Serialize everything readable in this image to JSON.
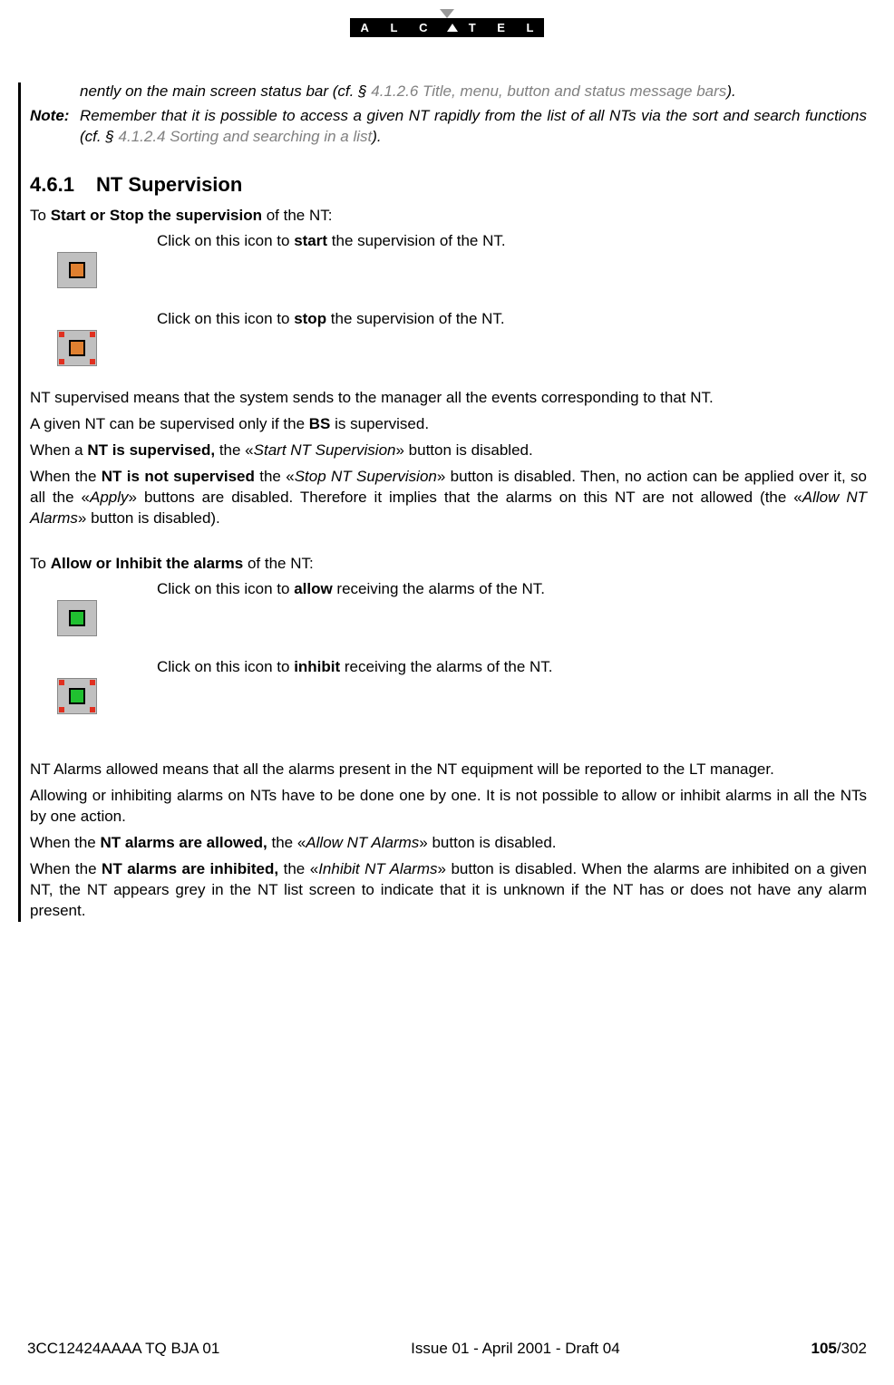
{
  "logo": {
    "text": "A L C ▲ T E L"
  },
  "intro": {
    "frag_continuation": "nently on the main screen status bar (cf. § ",
    "frag_link": "4.1.2.6 Title, menu, button and status message bars",
    "frag_end": ").",
    "note_label": "Note:",
    "note_text1": "Remember that it is possible to access a given NT rapidly from the list of all NTs via the sort and search functions (cf. § ",
    "note_link": "4.1.2.4 Sorting and searching in a list",
    "note_end": ")."
  },
  "section": {
    "number": "4.6.1",
    "title": "NT Supervision"
  },
  "sup": {
    "intro_pre": "To ",
    "intro_bold": "Start or Stop the supervision",
    "intro_post": " of the NT:",
    "start_pre": "Click on this icon to ",
    "start_bold": "start",
    "start_post": " the supervision of the NT.",
    "stop_pre": "Click on this icon to ",
    "stop_bold": "stop",
    "stop_post": " the supervision of the NT.",
    "p1": "NT supervised means that the system sends to the manager all the events corresponding to that NT.",
    "p2_pre": "A given NT can be supervised only if the ",
    "p2_bold": "BS",
    "p2_post": " is supervised.",
    "p3_pre": "When a ",
    "p3_bold": "NT is supervised,",
    "p3_mid": " the «",
    "p3_ital": "Start NT Supervision",
    "p3_post": "» button is disabled.",
    "p4_pre": "When the ",
    "p4_bold": "NT is not supervised",
    "p4_mid1": " the «",
    "p4_ital1": "Stop NT Supervision",
    "p4_mid2": "» button is disabled. Then, no action can be applied over it, so all the «",
    "p4_ital2": "Apply",
    "p4_mid3": "» buttons are disabled. Therefore it implies that the alarms on this NT are not allowed (the «",
    "p4_ital3": "Allow NT Alarms",
    "p4_post": "» button is disabled)."
  },
  "alarm": {
    "intro_pre": "To ",
    "intro_bold": "Allow or Inhibit the alarms",
    "intro_post": " of the NT:",
    "allow_pre": "Click on this icon to ",
    "allow_bold": "allow",
    "allow_post": " receiving the alarms of the NT.",
    "inhibit_pre": "Click on this icon to ",
    "inhibit_bold": "inhibit",
    "inhibit_post": " receiving the alarms of the NT.",
    "p1": "NT Alarms allowed means that all the alarms present in the NT equipment will be reported to the LT manager.",
    "p2": "Allowing or inhibiting alarms on NTs have to be done one by one. It is not possible to allow or inhibit alarms in all the NTs by one action.",
    "p3_pre": "When the ",
    "p3_bold": "NT alarms are allowed,",
    "p3_mid": " the «",
    "p3_ital": "Allow NT Alarms",
    "p3_post": "» button is disabled.",
    "p4_pre": "When the ",
    "p4_bold": "NT alarms are inhibited,",
    "p4_mid": " the «",
    "p4_ital": "Inhibit NT Alarms",
    "p4_post": "» button is disabled. When the alarms are inhibited on a given NT, the NT appears grey in the NT list screen to indicate that it is unknown if the NT has or does not have any alarm present."
  },
  "footer": {
    "left": "3CC12424AAAA TQ BJA 01",
    "center": "Issue 01 - April 2001 - Draft 04",
    "page_current": "105",
    "page_total": "/302"
  }
}
